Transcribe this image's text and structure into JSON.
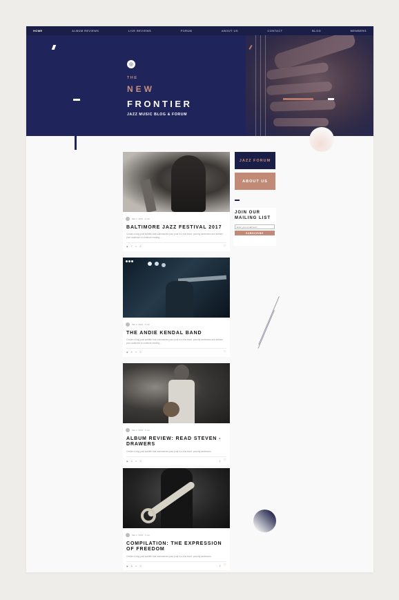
{
  "nav": {
    "items": [
      "Home",
      "Album Reviews",
      "Live Reviews",
      "Forum",
      "About Us",
      "Contact",
      "Blog",
      "Members"
    ],
    "active": 0
  },
  "hero": {
    "the": "THE",
    "new": "NEW",
    "frontier": "FRONTIER",
    "subtitle": "JAZZ MUSIC BLOG & FORUM"
  },
  "sidebar": {
    "forum_button": "Jazz Forum",
    "about_button": "About Us",
    "mailing_title": "JOIN OUR MAILING LIST",
    "email_placeholder": "Enter your email here*",
    "subscribe_label": "SUBSCRIBE"
  },
  "posts": [
    {
      "date": "Mar 2, 2019 · 1 min",
      "title": "BALTIMORE JAZZ FESTIVAL 2017",
      "excerpt": "Create a blog post subtitle that summarizes your post in a few short, punchy sentences and entices your audience to continue reading....",
      "views": "7",
      "comments": "0",
      "likes": ""
    },
    {
      "date": "Mar 2, 2019 · 1 min",
      "title": "THE ANDIE KENDAL BAND",
      "excerpt": "Create a blog post subtitle that summarizes your post in a few short, punchy sentences and entices your audience to continue reading....",
      "views": "4",
      "comments": "0",
      "likes": ""
    },
    {
      "date": "Mar 2, 2019 · 1 min",
      "title": "ALBUM REVIEW: READ STEVEN - DRAWERS",
      "excerpt": "Create a blog post subtitle that summarizes your post in a few short, punchy sentences.",
      "views": "4",
      "comments": "0",
      "likes": "1"
    },
    {
      "date": "Mar 2, 2019 · 1 min",
      "title": "COMPILATION: THE EXPRESSION OF FREEDOM",
      "excerpt": "Create a blog post subtitle that summarizes your post in a few short, punchy sentences.",
      "views": "6",
      "comments": "0",
      "likes": "2"
    }
  ],
  "icons": {
    "logo": "vinyl-icon",
    "views": "eye-icon",
    "comments": "comment-icon",
    "likes": "heart-icon"
  },
  "colors": {
    "navy": "#1b1e46",
    "hero_blue": "#1f245a",
    "copper": "#c08a77"
  }
}
